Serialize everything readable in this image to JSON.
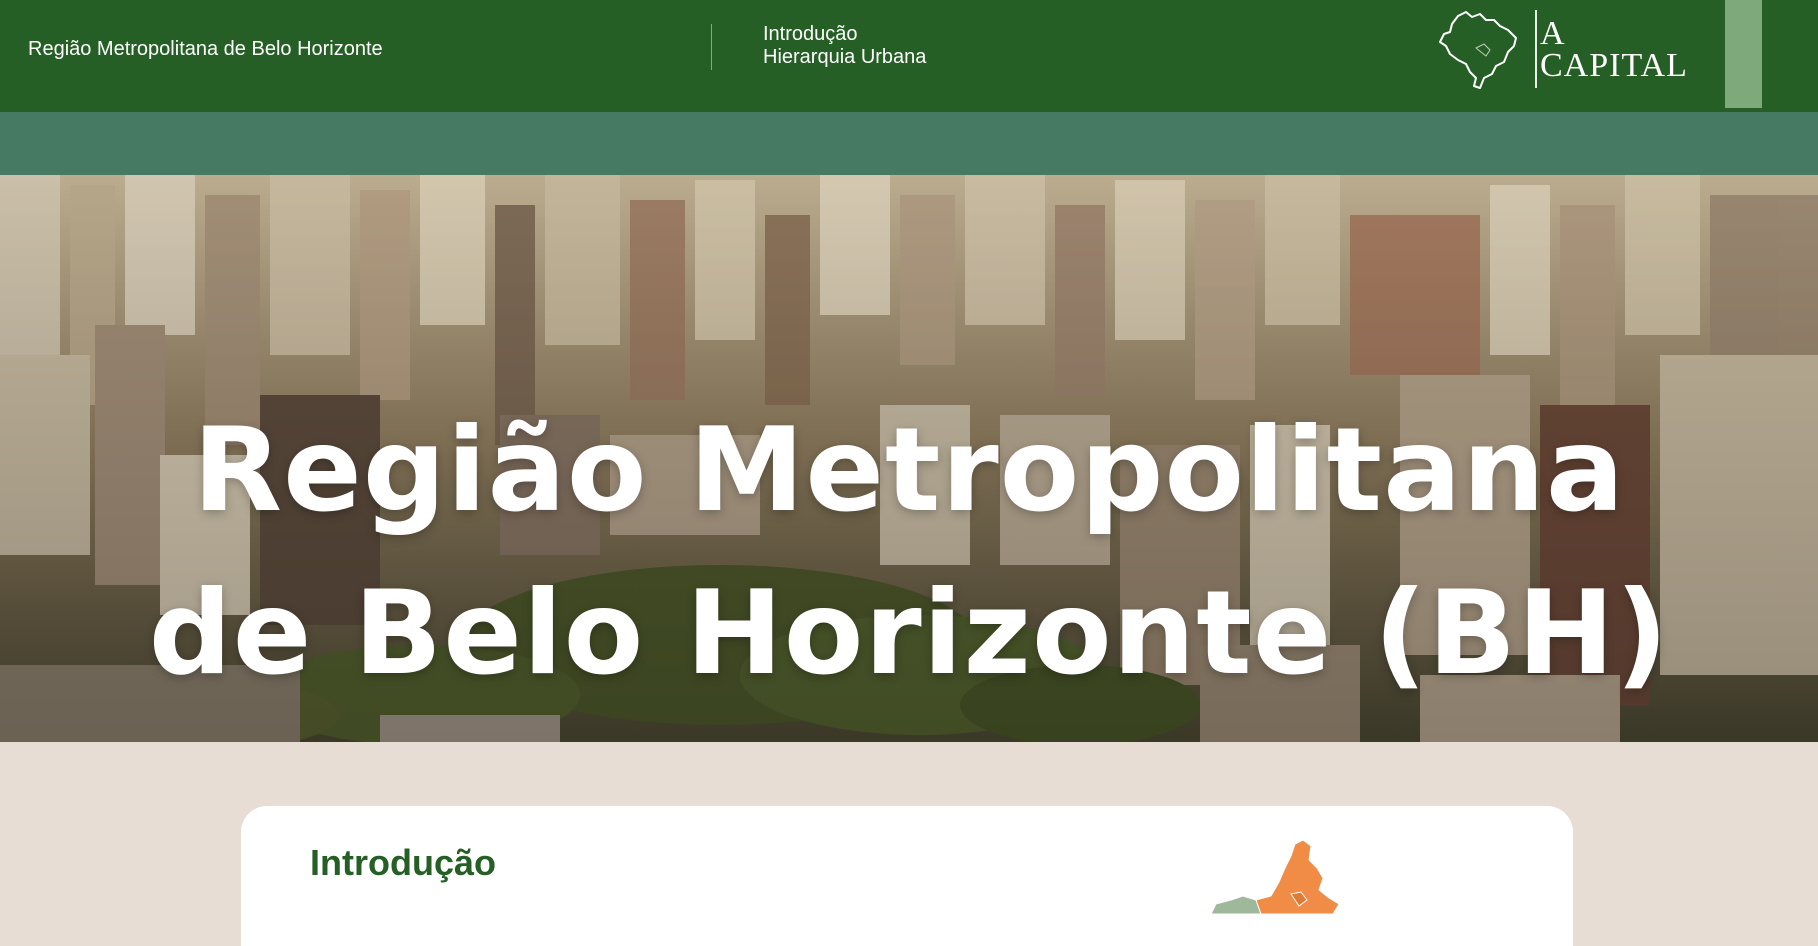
{
  "header": {
    "site_title": "Região Metropolitana de Belo Horizonte",
    "nav": [
      {
        "label": "Introdução"
      },
      {
        "label": "Hierarquia Urbana"
      }
    ],
    "brand": {
      "line1": "A",
      "line2": "CAPITAL",
      "icon": "brazil-map-icon"
    },
    "menu_icon": "menu-tab"
  },
  "hero": {
    "title_line1": "Região Metropolitana",
    "title_line2": "de Belo Horizonte (BH)",
    "background": "aerial-city-photo"
  },
  "content": {
    "intro_heading": "Introdução",
    "map_image": "rmbh-municipalities-map"
  },
  "colors": {
    "header_bg": "#255f25",
    "subband_bg": "#467a62",
    "page_bg": "#e7ddd4",
    "accent_green": "#255f25",
    "map_orange": "#f08c45",
    "map_green": "#9fb79a"
  }
}
